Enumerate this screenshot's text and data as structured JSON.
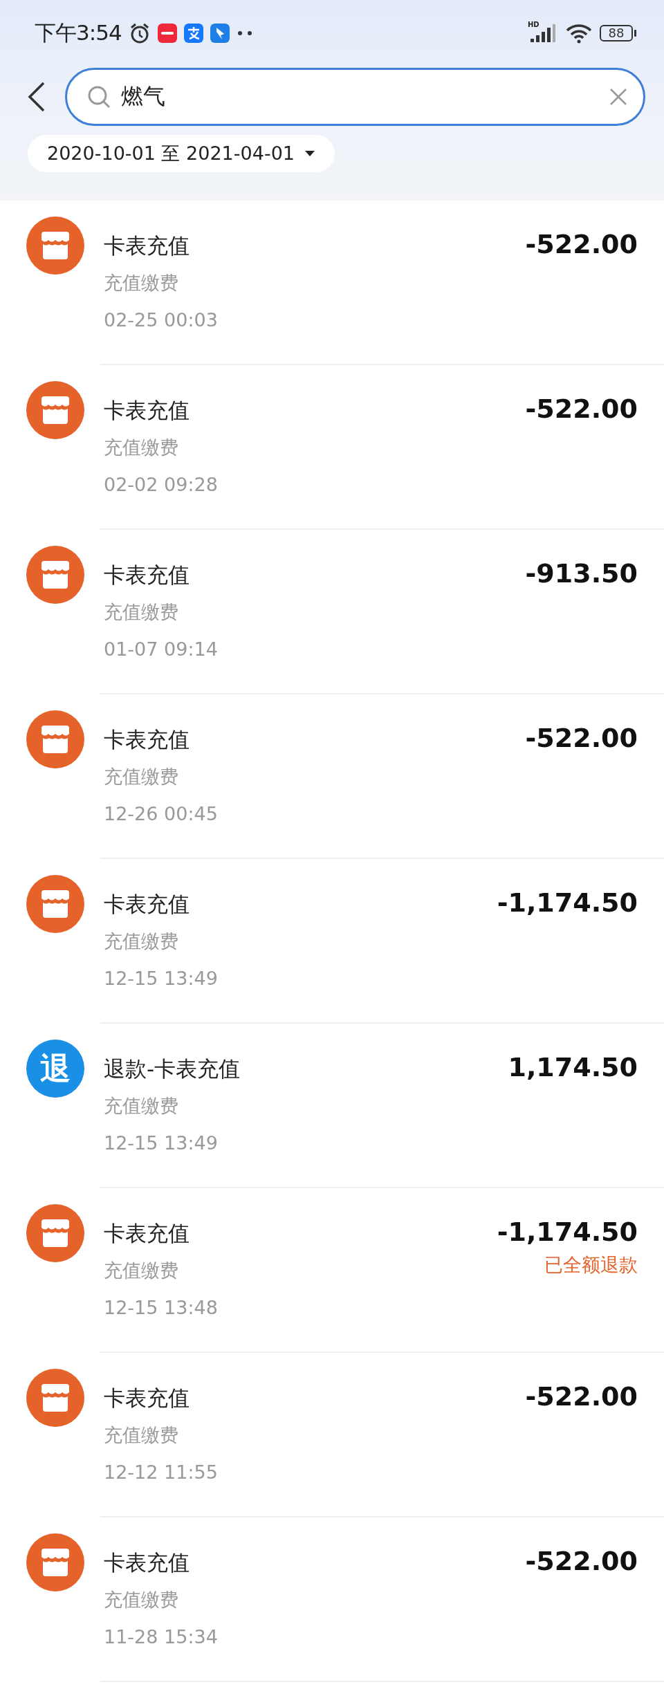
{
  "status_bar": {
    "time": "下午3:54",
    "signal_label": "HD",
    "battery": "88"
  },
  "search": {
    "value": "燃气"
  },
  "date_range": {
    "label": "2020-10-01 至 2021-04-01"
  },
  "transactions": [
    {
      "kind": "payment",
      "title": "卡表充值",
      "category": "充值缴费",
      "time": "02-25 00:03",
      "amount": "-522.00"
    },
    {
      "kind": "payment",
      "title": "卡表充值",
      "category": "充值缴费",
      "time": "02-02 09:28",
      "amount": "-522.00"
    },
    {
      "kind": "payment",
      "title": "卡表充值",
      "category": "充值缴费",
      "time": "01-07 09:14",
      "amount": "-913.50"
    },
    {
      "kind": "payment",
      "title": "卡表充值",
      "category": "充值缴费",
      "time": "12-26 00:45",
      "amount": "-522.00"
    },
    {
      "kind": "payment",
      "title": "卡表充值",
      "category": "充值缴费",
      "time": "12-15 13:49",
      "amount": "-1,174.50"
    },
    {
      "kind": "refund",
      "badge": "退",
      "title": "退款-卡表充值",
      "category": "充值缴费",
      "time": "12-15 13:49",
      "amount": "1,174.50"
    },
    {
      "kind": "payment",
      "title": "卡表充值",
      "category": "充值缴费",
      "time": "12-15 13:48",
      "amount": "-1,174.50",
      "note": "已全额退款"
    },
    {
      "kind": "payment",
      "title": "卡表充值",
      "category": "充值缴费",
      "time": "12-12 11:55",
      "amount": "-522.00"
    },
    {
      "kind": "payment",
      "title": "卡表充值",
      "category": "充值缴费",
      "time": "11-28 15:34",
      "amount": "-522.00"
    }
  ]
}
